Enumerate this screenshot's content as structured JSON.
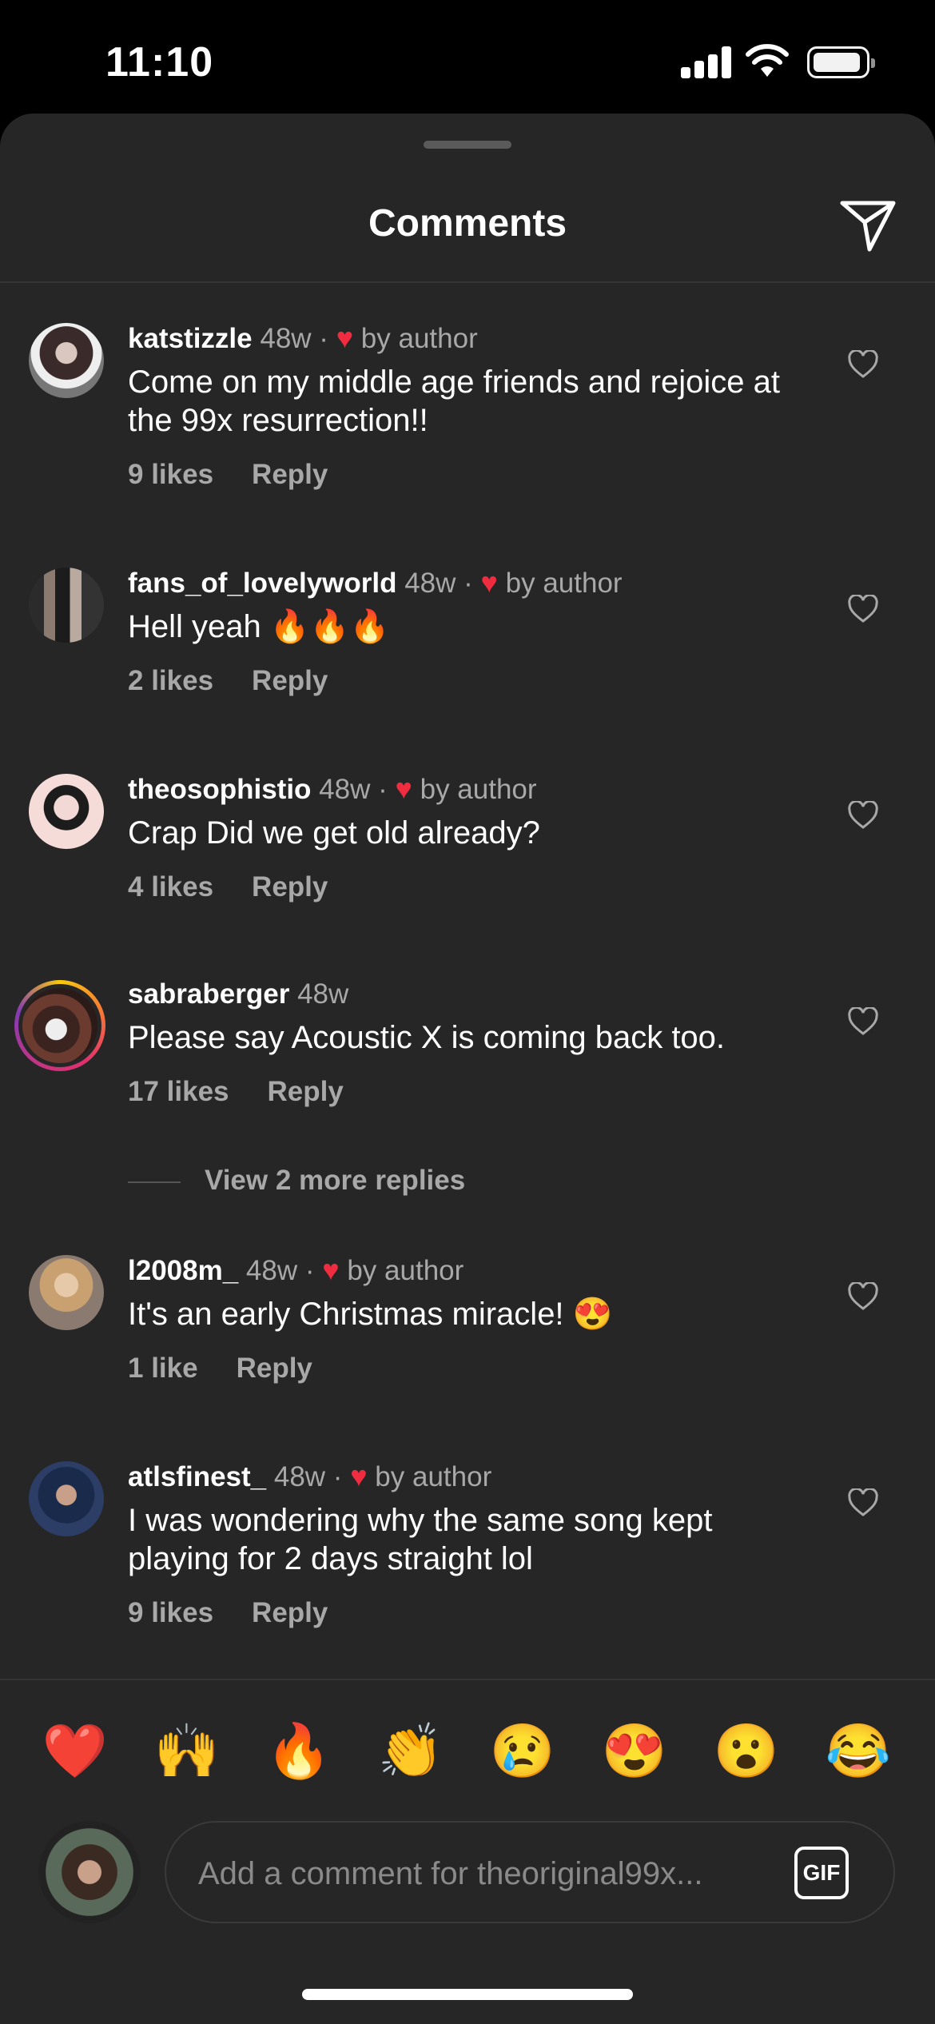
{
  "status_bar": {
    "time": "11:10"
  },
  "header": {
    "title": "Comments"
  },
  "comments": [
    {
      "user": "katstizzle",
      "age": "48w",
      "sep": " · ",
      "liked_by_author": "by author",
      "text": "Come on my middle age friends and rejoice at the 99x resurrection!!",
      "likes": "9 likes",
      "reply": "Reply"
    },
    {
      "user": "fans_of_lovelyworld",
      "age": "48w",
      "sep": " · ",
      "liked_by_author": "by author",
      "text": "Hell yeah 🔥🔥🔥",
      "likes": "2 likes",
      "reply": "Reply"
    },
    {
      "user": "theosophistio",
      "age": "48w",
      "sep": " · ",
      "liked_by_author": "by author",
      "text": "Crap Did we get old already?",
      "likes": "4 likes",
      "reply": "Reply"
    },
    {
      "user": "sabraberger",
      "age": "48w",
      "text": "Please say Acoustic X is coming back too.",
      "likes": "17 likes",
      "reply": "Reply"
    },
    {
      "user": "l2008m_",
      "age": "48w",
      "sep": " · ",
      "liked_by_author": "by author",
      "text": "It's an early Christmas miracle! 😍",
      "likes": "1 like",
      "reply": "Reply"
    },
    {
      "user": "atlsfinest_",
      "age": "48w",
      "sep": " · ",
      "liked_by_author": "by author",
      "text": "I was wondering why the same song kept playing for 2 days straight lol",
      "likes": "9 likes",
      "reply": "Reply"
    }
  ],
  "view_more_replies": "View 2 more replies",
  "quick_reactions": [
    "❤️",
    "🙌",
    "🔥",
    "👏",
    "😢",
    "😍",
    "😮",
    "😂"
  ],
  "composer": {
    "placeholder": "Add a comment for theoriginal99x...",
    "gif_label": "GIF"
  },
  "colors": {
    "background": "#262626",
    "heart_red": "#ef2c40",
    "secondary_text": "#a8a8a8"
  },
  "icons": {
    "send": "paper-plane-icon",
    "like": "heart-outline-icon",
    "author_like": "heart-filled-icon"
  }
}
